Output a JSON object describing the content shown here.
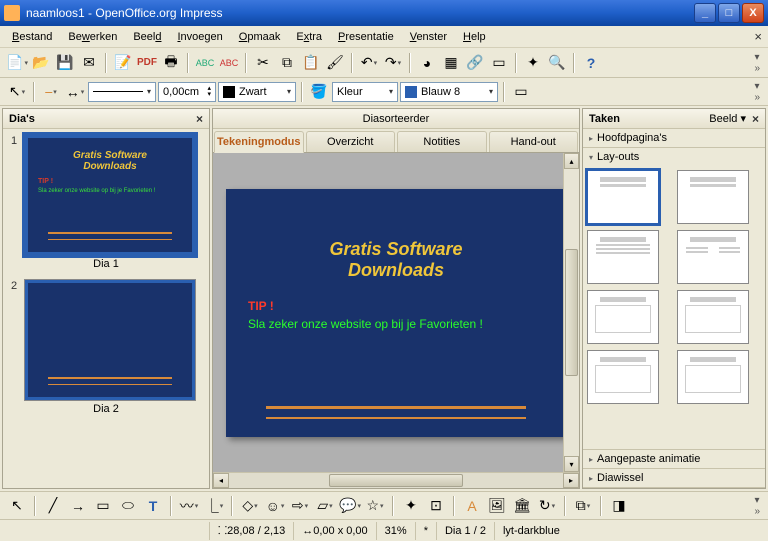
{
  "window": {
    "title": "naamloos1 - OpenOffice.org Impress"
  },
  "menu": [
    "Bestand",
    "Bewerken",
    "Beeld",
    "Invoegen",
    "Opmaak",
    "Extra",
    "Presentatie",
    "Venster",
    "Help"
  ],
  "toolbar2": {
    "line_width": "0,00cm",
    "color1_name": "Zwart",
    "color1_hex": "#000000",
    "fill_mode": "Kleur",
    "color2_name": "Blauw 8",
    "color2_hex": "#2a5fb0"
  },
  "slidepanel": {
    "title": "Dia's",
    "slides": [
      {
        "num": "1",
        "label": "Dia 1"
      },
      {
        "num": "2",
        "label": "Dia 2"
      }
    ]
  },
  "center": {
    "top_tab": "Diasorteerder",
    "tabs": [
      "Tekeningmodus",
      "Overzicht",
      "Notities",
      "Hand-out"
    ],
    "active_tab": 0
  },
  "slide_content": {
    "title_line1": "Gratis Software",
    "title_line2": "Downloads",
    "tip_label": "TIP !",
    "tip_text": "Sla zeker onze website op bij je Favorieten !"
  },
  "tasks": {
    "title": "Taken",
    "view_label": "Beeld",
    "sections": {
      "master": "Hoofdpagina's",
      "layouts": "Lay-outs",
      "anim": "Aangepaste animatie",
      "trans": "Diawissel"
    }
  },
  "status": {
    "coords": "28,08 / 2,13",
    "size": "0,00 x 0,00",
    "zoom": "31%",
    "modified": "*",
    "slide": "Dia 1 / 2",
    "template": "lyt-darkblue"
  }
}
